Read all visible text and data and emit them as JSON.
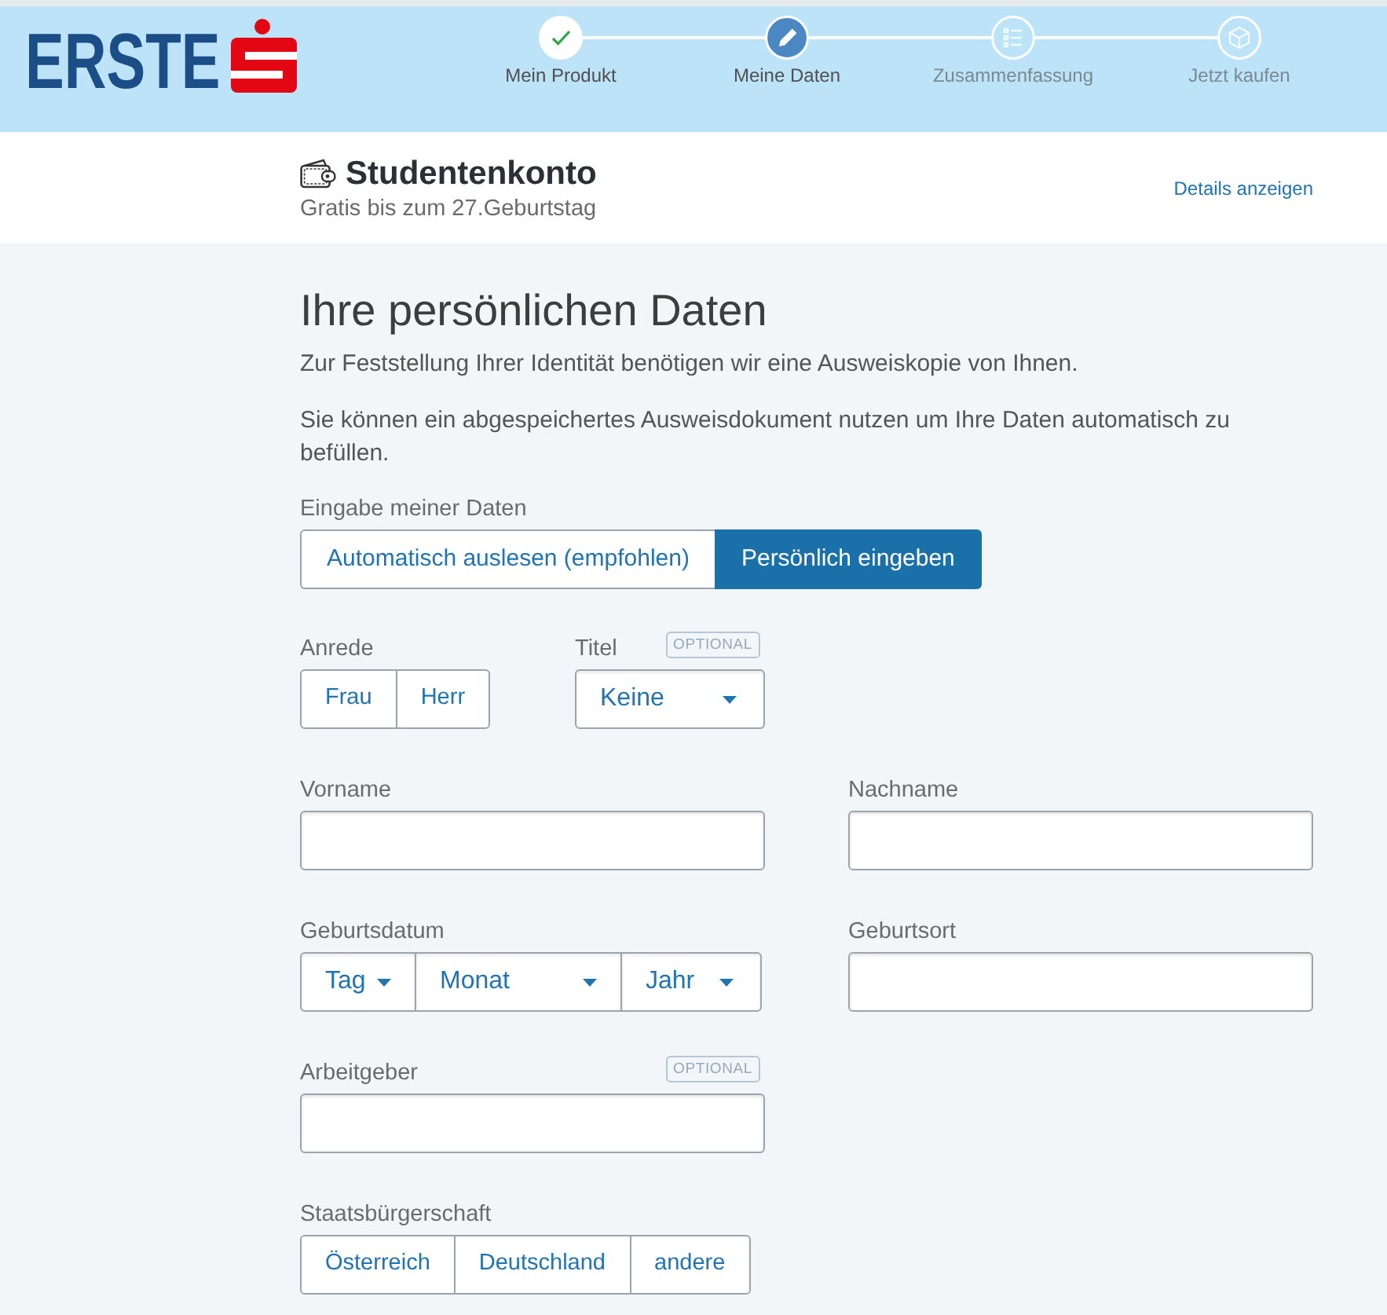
{
  "header": {
    "logo": "ERSTE",
    "steps": [
      {
        "label": "Mein Produkt",
        "done": true,
        "selected": false
      },
      {
        "label": "Meine Daten",
        "done": false,
        "selected": true
      },
      {
        "label": "Zusammenfassung",
        "done": false,
        "selected": false
      },
      {
        "label": "Jetzt kaufen",
        "done": false,
        "selected": false
      }
    ]
  },
  "product": {
    "title": "Studentenkonto",
    "subtitle": "Gratis bis zum 27.Geburtstag",
    "details_link": "Details anzeigen"
  },
  "form": {
    "heading": "Ihre persönlichen Daten",
    "intro": [
      "Zur Feststellung Ihrer Identität benötigen wir eine Ausweiskopie von Ihnen.",
      "Sie können ein abgespeichertes Ausweisdokument nutzen um Ihre Daten automatisch zu befüllen."
    ],
    "input_mode": {
      "label": "Eingabe meiner Daten",
      "options": [
        {
          "label": "Automatisch auslesen (empfohlen)",
          "selected": false
        },
        {
          "label": "Persönlich eingeben",
          "selected": true
        }
      ]
    },
    "rows": [
      {
        "kind": "pair",
        "fields": [
          {
            "kind": "choice",
            "label": "Anrede",
            "options": [
              {
                "label": "Frau",
                "selected": false
              },
              {
                "label": "Herr",
                "selected": false
              }
            ]
          },
          {
            "kind": "select",
            "label": "Titel",
            "badge": "OPTIONAL",
            "value": "Keine"
          }
        ]
      },
      {
        "kind": "columns",
        "fields": [
          {
            "kind": "text",
            "label": "Vorname"
          },
          {
            "kind": "text",
            "label": "Nachname"
          }
        ]
      },
      {
        "kind": "columns",
        "fields": [
          {
            "kind": "date",
            "label": "Geburtsdatum",
            "parts": [
              {
                "value": "Tag"
              },
              {
                "value": "Monat"
              },
              {
                "value": "Jahr"
              }
            ]
          },
          {
            "kind": "text",
            "label": "Geburtsort"
          }
        ]
      },
      {
        "kind": "columns",
        "fields": [
          {
            "kind": "text",
            "label": "Arbeitgeber",
            "badge": "OPTIONAL"
          }
        ]
      },
      {
        "kind": "columns",
        "fields": [
          {
            "kind": "choice",
            "label": "Staatsbürgerschaft",
            "options": [
              {
                "label": "Österreich",
                "selected": false
              },
              {
                "label": "Deutschland",
                "selected": false
              },
              {
                "label": "andere",
                "selected": false
              }
            ]
          }
        ]
      }
    ]
  }
}
